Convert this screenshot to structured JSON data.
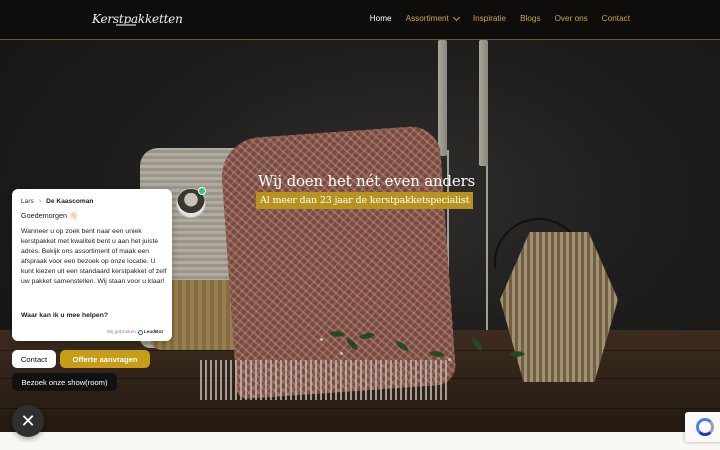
{
  "header": {
    "logo_text": "Kerstpakketten",
    "nav": [
      {
        "label": "Home",
        "active": true
      },
      {
        "label": "Assortiment",
        "has_dropdown": true
      },
      {
        "label": "Inspiratie"
      },
      {
        "label": "Blogs"
      },
      {
        "label": "Over ons"
      },
      {
        "label": "Contact"
      }
    ]
  },
  "hero": {
    "title": "Wij doen het nét even anders",
    "subtitle": "Al meer dan 23 jaar de kerstpakketspecialist"
  },
  "chat": {
    "breadcrumb_agent": "Lars",
    "breadcrumb_company": "De Kaascoman",
    "greeting": "Goedemorgen 👋🏻",
    "message": "Wanneer u op zoek bent naar een uniek kerstpakket met kwaliteit bent u aan het juiste adres. Bekijk ons assortiment of maak een afspraak voor een bezoek op onze locatie. U kunt kiezen uit een standaard kerstpakket of zelf uw pakket samenstellen. Wij staan voor u klaar!",
    "question": "Waar kan ik u mee helpen?",
    "powered_prefix": "Wij gebruiken",
    "powered_brand": "LeadBot",
    "buttons": {
      "contact": "Contact",
      "offerte": "Offerte aanvragen",
      "showroom": "Bezoek onze show(room)"
    },
    "close_symbol": "✕"
  },
  "colors": {
    "accent_gold": "#c79d18",
    "header_bg": "#0e0d0c",
    "online": "#33c56b"
  }
}
